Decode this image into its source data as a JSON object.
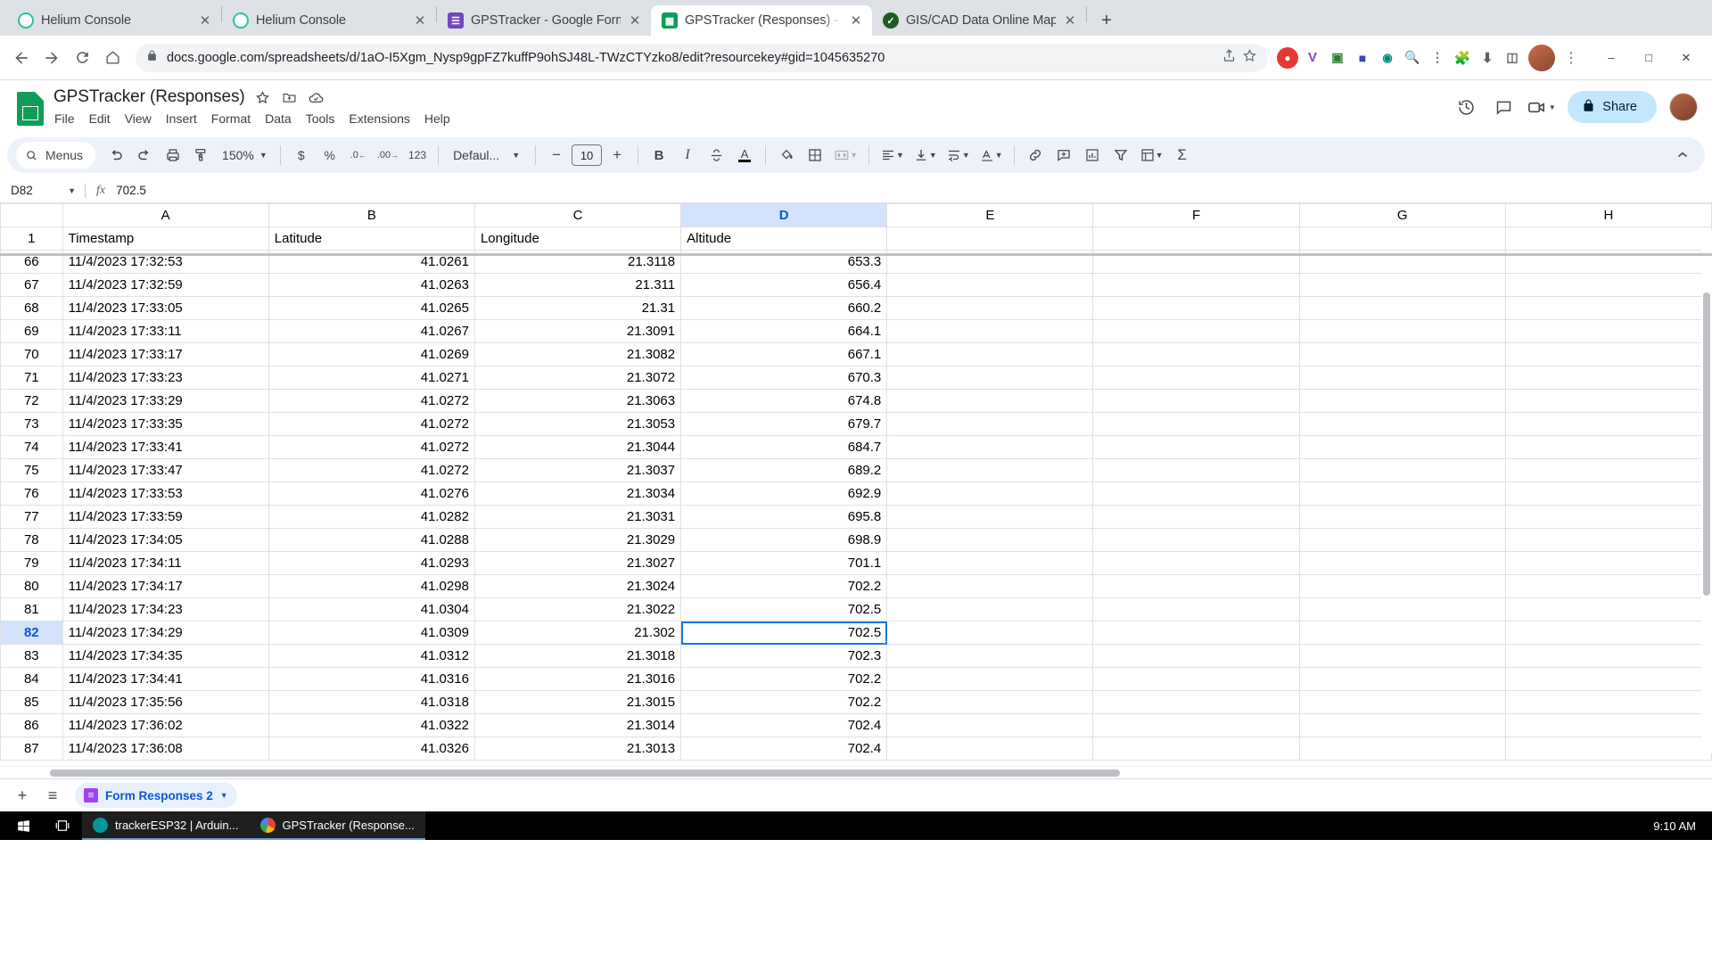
{
  "browser": {
    "tabs": [
      {
        "title": "Helium Console",
        "favicon": "helium-icon",
        "active": false
      },
      {
        "title": "Helium Console",
        "favicon": "helium-icon",
        "active": false
      },
      {
        "title": "GPSTracker - Google Forms",
        "favicon": "google-forms-icon",
        "active": false
      },
      {
        "title": "GPSTracker (Responses) - Goog",
        "favicon": "google-sheets-icon",
        "active": true
      },
      {
        "title": "GIS/CAD Data Online Map View",
        "favicon": "gis-shield-icon",
        "active": false
      }
    ],
    "new_tab_label": "+",
    "url": "docs.google.com/spreadsheets/d/1aO-I5Xgm_Nysp9gpFZ7kuffP9ohSJ48L-TWzCTYzko8/edit?resourcekey#gid=1045635270",
    "window_controls": {
      "minimize": "–",
      "maximize": "□",
      "close": "✕"
    }
  },
  "sheets": {
    "doc_title": "GPSTracker (Responses)",
    "menus": [
      "File",
      "Edit",
      "View",
      "Insert",
      "Format",
      "Data",
      "Tools",
      "Extensions",
      "Help"
    ],
    "share_label": "Share",
    "toolbar": {
      "search_label": "Menus",
      "zoom_level": "150%",
      "currency": "$",
      "percent": "%",
      "decrease_decimal": ".0",
      "increase_decimal": ".00",
      "more_formats": "123",
      "font_name": "Defaul...",
      "font_size": "10",
      "bold": "B",
      "italic": "I",
      "strikethrough": "S",
      "text_color": "A",
      "sum": "Σ"
    },
    "formula_bar": {
      "cell_reference": "D82",
      "fx_label": "fx",
      "value": "702.5"
    },
    "grid": {
      "column_headers": [
        "A",
        "B",
        "C",
        "D",
        "E",
        "F",
        "G",
        "H"
      ],
      "selected_column": "D",
      "selected_row": "82",
      "selected_cell": "D82",
      "header_row_number": "1",
      "header_row": [
        "Timestamp",
        "Latitude",
        "Longitude",
        "Altitude",
        "",
        "",
        "",
        ""
      ],
      "rows": [
        {
          "n": "66",
          "cells": [
            "11/4/2023 17:32:53",
            "41.0261",
            "21.3118",
            "653.3",
            "",
            "",
            "",
            ""
          ]
        },
        {
          "n": "67",
          "cells": [
            "11/4/2023 17:32:59",
            "41.0263",
            "21.311",
            "656.4",
            "",
            "",
            "",
            ""
          ]
        },
        {
          "n": "68",
          "cells": [
            "11/4/2023 17:33:05",
            "41.0265",
            "21.31",
            "660.2",
            "",
            "",
            "",
            ""
          ]
        },
        {
          "n": "69",
          "cells": [
            "11/4/2023 17:33:11",
            "41.0267",
            "21.3091",
            "664.1",
            "",
            "",
            "",
            ""
          ]
        },
        {
          "n": "70",
          "cells": [
            "11/4/2023 17:33:17",
            "41.0269",
            "21.3082",
            "667.1",
            "",
            "",
            "",
            ""
          ]
        },
        {
          "n": "71",
          "cells": [
            "11/4/2023 17:33:23",
            "41.0271",
            "21.3072",
            "670.3",
            "",
            "",
            "",
            ""
          ]
        },
        {
          "n": "72",
          "cells": [
            "11/4/2023 17:33:29",
            "41.0272",
            "21.3063",
            "674.8",
            "",
            "",
            "",
            ""
          ]
        },
        {
          "n": "73",
          "cells": [
            "11/4/2023 17:33:35",
            "41.0272",
            "21.3053",
            "679.7",
            "",
            "",
            "",
            ""
          ]
        },
        {
          "n": "74",
          "cells": [
            "11/4/2023 17:33:41",
            "41.0272",
            "21.3044",
            "684.7",
            "",
            "",
            "",
            ""
          ]
        },
        {
          "n": "75",
          "cells": [
            "11/4/2023 17:33:47",
            "41.0272",
            "21.3037",
            "689.2",
            "",
            "",
            "",
            ""
          ]
        },
        {
          "n": "76",
          "cells": [
            "11/4/2023 17:33:53",
            "41.0276",
            "21.3034",
            "692.9",
            "",
            "",
            "",
            ""
          ]
        },
        {
          "n": "77",
          "cells": [
            "11/4/2023 17:33:59",
            "41.0282",
            "21.3031",
            "695.8",
            "",
            "",
            "",
            ""
          ]
        },
        {
          "n": "78",
          "cells": [
            "11/4/2023 17:34:05",
            "41.0288",
            "21.3029",
            "698.9",
            "",
            "",
            "",
            ""
          ]
        },
        {
          "n": "79",
          "cells": [
            "11/4/2023 17:34:11",
            "41.0293",
            "21.3027",
            "701.1",
            "",
            "",
            "",
            ""
          ]
        },
        {
          "n": "80",
          "cells": [
            "11/4/2023 17:34:17",
            "41.0298",
            "21.3024",
            "702.2",
            "",
            "",
            "",
            ""
          ]
        },
        {
          "n": "81",
          "cells": [
            "11/4/2023 17:34:23",
            "41.0304",
            "21.3022",
            "702.5",
            "",
            "",
            "",
            ""
          ]
        },
        {
          "n": "82",
          "cells": [
            "11/4/2023 17:34:29",
            "41.0309",
            "21.302",
            "702.5",
            "",
            "",
            "",
            ""
          ]
        },
        {
          "n": "83",
          "cells": [
            "11/4/2023 17:34:35",
            "41.0312",
            "21.3018",
            "702.3",
            "",
            "",
            "",
            ""
          ]
        },
        {
          "n": "84",
          "cells": [
            "11/4/2023 17:34:41",
            "41.0316",
            "21.3016",
            "702.2",
            "",
            "",
            "",
            ""
          ]
        },
        {
          "n": "85",
          "cells": [
            "11/4/2023 17:35:56",
            "41.0318",
            "21.3015",
            "702.2",
            "",
            "",
            "",
            ""
          ]
        },
        {
          "n": "86",
          "cells": [
            "11/4/2023 17:36:02",
            "41.0322",
            "21.3014",
            "702.4",
            "",
            "",
            "",
            ""
          ]
        },
        {
          "n": "87",
          "cells": [
            "11/4/2023 17:36:08",
            "41.0326",
            "21.3013",
            "702.4",
            "",
            "",
            "",
            ""
          ]
        }
      ]
    },
    "sheet_tabs": {
      "add_label": "+",
      "all_sheets_label": "≡",
      "active_tab": "Form Responses 2"
    }
  },
  "taskbar": {
    "items": [
      {
        "label": "trackerESP32 | Arduin...",
        "icon": "arduino-icon"
      },
      {
        "label": "GPSTracker (Response...",
        "icon": "chrome-icon"
      }
    ],
    "clock": "9:10 AM"
  }
}
